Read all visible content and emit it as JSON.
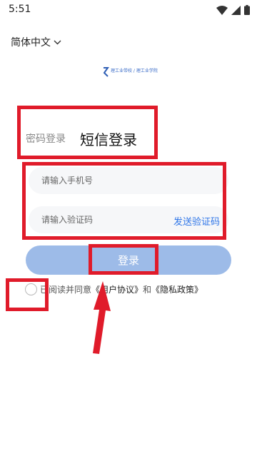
{
  "status": {
    "time": "5:51"
  },
  "language": {
    "label": "简体中文"
  },
  "logo": {
    "text": "理工业带校 / 理工业学院"
  },
  "tabs": {
    "password": "密码登录",
    "sms": "短信登录"
  },
  "form": {
    "phone_placeholder": "请输入手机号",
    "code_placeholder": "请输入验证码",
    "send_code": "发送验证码"
  },
  "login": {
    "label": "登录"
  },
  "agreement": {
    "prefix": "已阅读并同意",
    "user_agreement": "《用户协议》",
    "and": "和",
    "privacy_policy": "《隐私政策》"
  },
  "colors": {
    "accent": "#2f76e8",
    "button": "#9dbbe8",
    "annotation": "#e01b2a"
  }
}
